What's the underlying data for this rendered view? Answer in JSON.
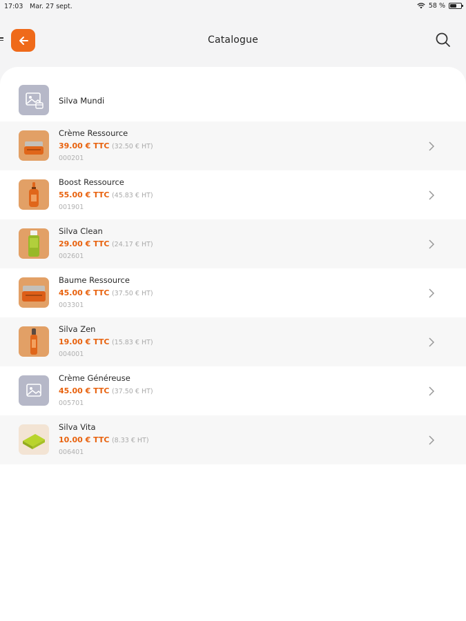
{
  "status": {
    "time": "17:03",
    "date": "Mar. 27 sept.",
    "battery": "58 %"
  },
  "header": {
    "title": "Catalogue",
    "back_icon": "arrow-left-icon",
    "search_icon": "search-icon"
  },
  "brand": {
    "name": "Silva Mundi",
    "icon": "image-placeholder-icon"
  },
  "products": [
    {
      "name": "Crème Ressource",
      "ttc": "39.00 € TTC",
      "ht": "(32.50 € HT)",
      "ref": "000201"
    },
    {
      "name": "Boost Ressource",
      "ttc": "55.00 € TTC",
      "ht": "(45.83 € HT)",
      "ref": "001901"
    },
    {
      "name": "Silva Clean",
      "ttc": "29.00 € TTC",
      "ht": "(24.17 € HT)",
      "ref": "002601"
    },
    {
      "name": "Baume Ressource",
      "ttc": "45.00 € TTC",
      "ht": "(37.50 € HT)",
      "ref": "003301"
    },
    {
      "name": "Silva Zen",
      "ttc": "19.00 € TTC",
      "ht": "(15.83 € HT)",
      "ref": "004001"
    },
    {
      "name": "Crème Généreuse",
      "ttc": "45.00 € TTC",
      "ht": "(37.50 € HT)",
      "ref": "005701"
    },
    {
      "name": "Silva Vita",
      "ttc": "10.00 € TTC",
      "ht": "(8.33 € HT)",
      "ref": "006401"
    }
  ],
  "colors": {
    "accent": "#ef6a1a",
    "price": "#e8620e",
    "placeholder": "#b6b8c8"
  }
}
